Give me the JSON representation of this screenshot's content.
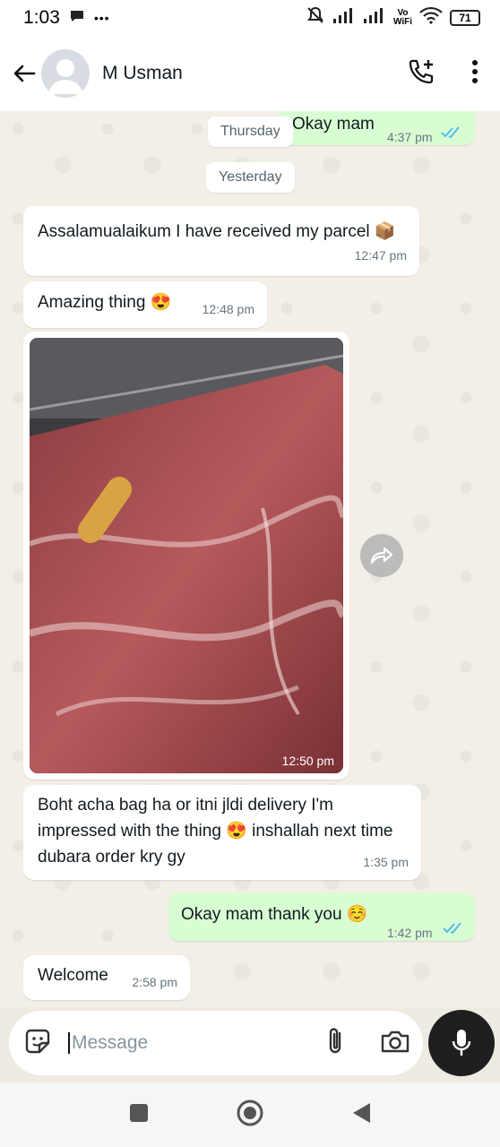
{
  "status_bar": {
    "time": "1:03",
    "dots": "•••",
    "network_label_top": "Vo",
    "network_label_bottom": "WiFi",
    "battery": "71"
  },
  "header": {
    "contact_name": "M Usman"
  },
  "chat": {
    "messages_top": [
      {
        "direction": "out",
        "text": "Okay mam",
        "time": "4:37 pm",
        "read": true
      }
    ],
    "date_thursday": "Thursday",
    "date_yesterday": "Yesterday",
    "msg1": {
      "text": "Assalamualaikum I have received my parcel 📦",
      "time": "12:47 pm"
    },
    "msg2": {
      "text": "Amazing thing 😍",
      "time": "12:48 pm"
    },
    "image_msg": {
      "time": "12:50 pm"
    },
    "msg3": {
      "text": "Boht acha bag ha or itni jldi delivery I'm impressed with the thing 😍 inshallah next time dubara order kry gy",
      "time": "1:35 pm"
    },
    "msg4": {
      "text": "Okay mam thank you ☺️",
      "time": "1:42 pm",
      "read": true
    },
    "msg5": {
      "text": "Welcome",
      "time": "2:58 pm"
    }
  },
  "composer": {
    "placeholder": "Message"
  },
  "colors": {
    "incoming_bubble": "#ffffff",
    "outgoing_bubble": "#d9fdd3",
    "read_ticks": "#53bdeb",
    "chat_background": "#f3eee6"
  },
  "icons": [
    "back-arrow-icon",
    "add-call-icon",
    "more-vertical-icon",
    "sticker-icon",
    "attach-icon",
    "camera-icon",
    "mic-icon",
    "forward-icon",
    "nav-square-icon",
    "nav-home-icon",
    "nav-back-icon"
  ]
}
